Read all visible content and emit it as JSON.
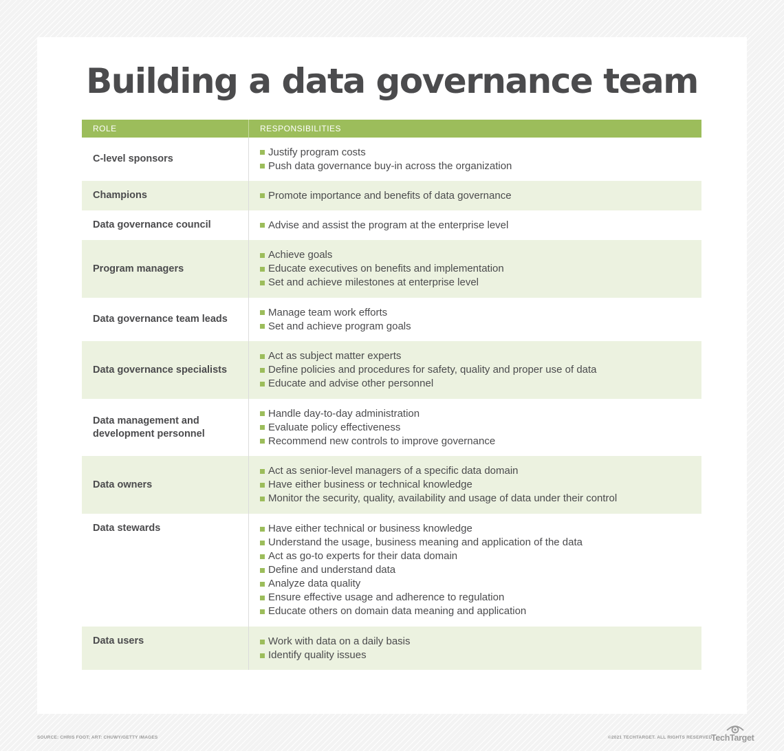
{
  "title": "Building a data governance team",
  "table": {
    "headers": {
      "role": "ROLE",
      "responsibilities": "RESPONSIBILITIES"
    },
    "accent_color": "#9cbd5b",
    "shade_color": "#ecf2e0",
    "rows": [
      {
        "role": "C-level sponsors",
        "items": [
          "Justify program costs",
          "Push data governance buy-in across the organization"
        ]
      },
      {
        "role": "Champions",
        "items": [
          "Promote importance and benefits of data governance"
        ]
      },
      {
        "role": "Data governance council",
        "items": [
          "Advise and assist the program at the enterprise level"
        ]
      },
      {
        "role": "Program managers",
        "items": [
          "Achieve goals",
          "Educate executives on benefits and implementation",
          "Set and achieve milestones at enterprise level"
        ]
      },
      {
        "role": "Data governance team leads",
        "items": [
          "Manage team work efforts",
          "Set and achieve program goals"
        ]
      },
      {
        "role": "Data governance specialists",
        "items": [
          "Act as subject matter experts",
          "Define policies and procedures for safety, quality and proper use of data",
          "Educate and advise other personnel"
        ]
      },
      {
        "role": "Data management and development personnel",
        "items": [
          "Handle day-to-day administration",
          "Evaluate policy effectiveness",
          "Recommend new controls to improve governance"
        ]
      },
      {
        "role": "Data owners",
        "items": [
          "Act as senior-level managers of a specific data domain",
          "Have either business or technical knowledge",
          "Monitor the security, quality, availability and usage of data under their control"
        ]
      },
      {
        "role": "Data stewards",
        "items": [
          "Have either technical or business knowledge",
          "Understand the usage, business meaning and application of the data",
          "Act as go-to experts for their data domain",
          "Define and understand data",
          "Analyze data quality",
          "Ensure effective usage and adherence to regulation",
          "Educate others on domain data meaning and application"
        ]
      },
      {
        "role": "Data users",
        "items": [
          "Work with data on a daily basis",
          "Identify quality issues"
        ]
      }
    ]
  },
  "footer": {
    "source": "SOURCE: CHRIS FOOT; ART: CHUWY/GETTY IMAGES",
    "copyright": "©2021 TECHTARGET. ALL RIGHTS RESERVED",
    "logo_text": "TechTarget",
    "logo_icon": "eye-icon"
  }
}
